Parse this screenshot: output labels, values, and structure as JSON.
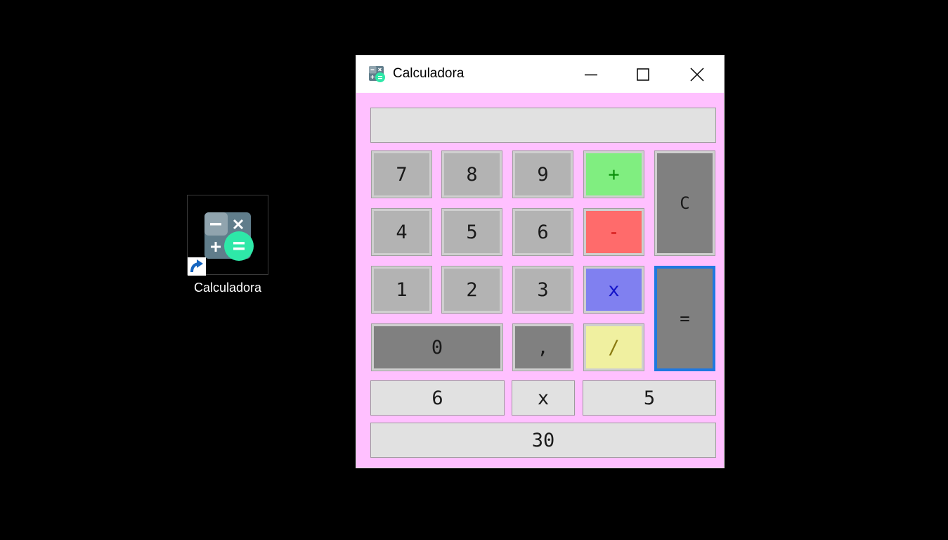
{
  "desktop": {
    "shortcut_label": "Calculadora",
    "logo_colors": {
      "tile": "#607d8b",
      "tile_light": "#90a4ae",
      "equals_circle": "#2ee8a8",
      "shortcut_badge": "#1565c0"
    }
  },
  "window": {
    "title": "Calculadora",
    "background": "#ffc0ff",
    "controls": {
      "minimize": "minimize-icon",
      "maximize": "maximize-icon",
      "close": "close-icon"
    }
  },
  "calculator": {
    "display_value": "",
    "keys": {
      "k7": "7",
      "k8": "8",
      "k9": "9",
      "plus": "+",
      "clear": "C",
      "k4": "4",
      "k5": "5",
      "k6": "6",
      "minus": "-",
      "k1": "1",
      "k2": "2",
      "k3": "3",
      "multiply": "x",
      "equals": "=",
      "k0": "0",
      "comma": ",",
      "divide": "/"
    },
    "operand1": "6",
    "operator": "x",
    "operand2": "5",
    "result": "30"
  }
}
